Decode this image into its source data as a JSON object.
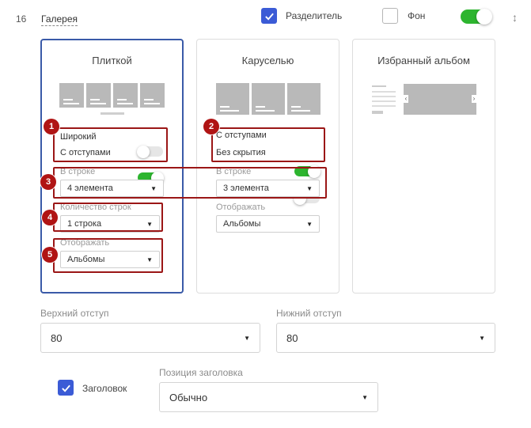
{
  "row": {
    "number": "16",
    "title": "Галерея"
  },
  "header": {
    "divider": {
      "label": "Разделитель",
      "checked": true
    },
    "background": {
      "label": "Фон",
      "checked": false
    },
    "enabled": true
  },
  "cards": [
    {
      "title": "Плиткой",
      "selected": true,
      "toggles": [
        {
          "label": "Широкий",
          "on": false
        },
        {
          "label": "С отступами",
          "on": true
        }
      ],
      "per_row": {
        "label": "В строке",
        "value": "4 элемента"
      },
      "rows_count": {
        "label": "Количество строк",
        "value": "1 строка"
      },
      "display": {
        "label": "Отображать",
        "value": "Альбомы"
      }
    },
    {
      "title": "Каруселью",
      "selected": false,
      "toggles": [
        {
          "label": "С отступами",
          "on": true
        },
        {
          "label": "Без скрытия",
          "on": false
        }
      ],
      "per_row": {
        "label": "В строке",
        "value": "3 элемента"
      },
      "display": {
        "label": "Отображать",
        "value": "Альбомы"
      }
    },
    {
      "title": "Избранный альбом",
      "selected": false
    }
  ],
  "margins": {
    "top": {
      "label": "Верхний отступ",
      "value": "80"
    },
    "bottom": {
      "label": "Нижний отступ",
      "value": "80"
    }
  },
  "heading": {
    "label": "Заголовок",
    "checked": true
  },
  "heading_position": {
    "label": "Позиция заголовка",
    "value": "Обычно"
  },
  "annotations": [
    "1",
    "2",
    "3",
    "4",
    "5"
  ],
  "colors": {
    "accent": "#3b5bd6",
    "toggle_on": "#2db52f",
    "annotation": "#b01414",
    "selected_border": "#3a5aa8"
  }
}
